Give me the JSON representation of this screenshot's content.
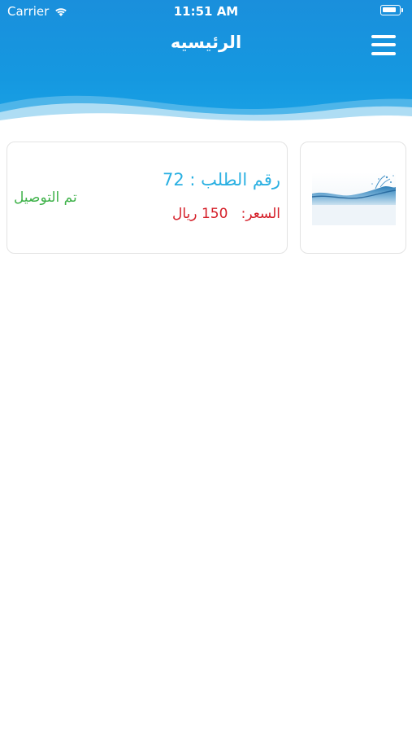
{
  "status_bar": {
    "carrier": "Carrier",
    "time": "11:51 AM",
    "battery_level": 0.8
  },
  "nav": {
    "title": "الرئيسيه",
    "menu_icon": "hamburger-menu-icon"
  },
  "orders": [
    {
      "number_text": "رقم الطلب : 72",
      "price_label": "السعر:",
      "price_value": "150",
      "currency": "ريال",
      "status": "تم التوصيل",
      "image_icon": "water-splash-image"
    }
  ],
  "colors": {
    "header_blue": "#1598e0",
    "order_number": "#2ab0e2",
    "price_red": "#d5202a",
    "status_green": "#3fb24a"
  }
}
